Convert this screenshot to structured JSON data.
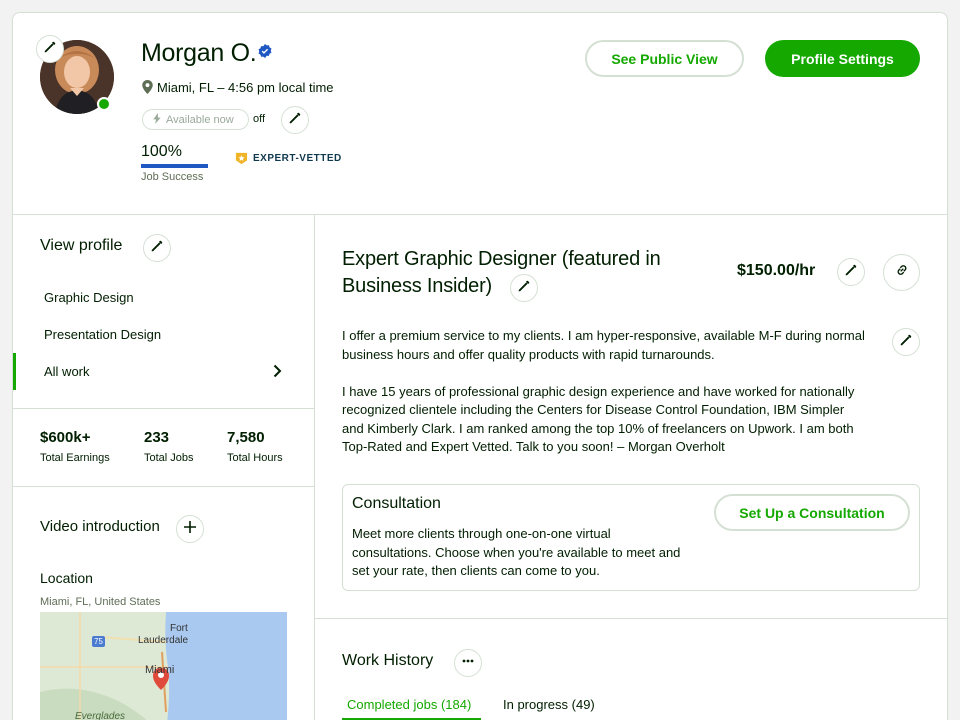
{
  "profile": {
    "name": "Morgan O.",
    "location": "Miami, FL – 4:56 pm local time",
    "availability_label": "Available now",
    "availability_state": "off",
    "job_success_value": "100%",
    "job_success_fraction": 1.0,
    "job_success_label": "Job Success",
    "badge_label": "EXPERT-VETTED",
    "online_status_color": "#14a800"
  },
  "header_actions": {
    "public_view_label": "See Public View",
    "settings_label": "Profile Settings"
  },
  "sidebar": {
    "view_profile_title": "View profile",
    "items": [
      {
        "label": "Graphic Design"
      },
      {
        "label": "Presentation Design"
      },
      {
        "label": "All work"
      }
    ],
    "stats": [
      {
        "value": "$600k+",
        "label": "Total Earnings"
      },
      {
        "value": "233",
        "label": "Total Jobs"
      },
      {
        "value": "7,580",
        "label": "Total Hours"
      }
    ],
    "video_title": "Video introduction",
    "location_title": "Location",
    "location_value": "Miami, FL, United States",
    "map_labels": {
      "fort": "Fort",
      "lauderdale": "Lauderdale",
      "miami": "Miami",
      "everglades": "Everglades",
      "route": "75"
    }
  },
  "main": {
    "title_line1": "Expert Graphic Designer (featured in",
    "title_line2": "Business Insider)",
    "rate": "$150.00/hr",
    "description_p1_l1": "I offer a premium service to my clients. I am hyper-responsive, available M-F during normal",
    "description_p1_l2": "business hours and offer quality products with rapid turnarounds.",
    "description_p2_l1": "I have 15 years of professional graphic design experience and have worked for nationally",
    "description_p2_l2": "recognized clientele including the Centers for Disease Control Foundation, IBM Simpler",
    "description_p2_l3": "and Kimberly Clark. I am ranked among the top 10% of freelancers on Upwork. I am both",
    "description_p2_l4": "Top-Rated and Expert Vetted. Talk to you soon! – Morgan Overholt",
    "consultation": {
      "title": "Consultation",
      "line1": "Meet more clients through one-on-one virtual",
      "line2": "consultations. Choose when you're available to meet and",
      "line3": "set your rate, then clients can come to you.",
      "button_label": "Set Up a Consultation"
    },
    "work_history": {
      "title": "Work History",
      "tabs": [
        {
          "label": "Completed jobs (184)",
          "active": true
        },
        {
          "label": "In progress (49)",
          "active": false
        }
      ]
    }
  },
  "colors": {
    "brand_green": "#14a800",
    "verified_blue": "#1f57c3",
    "badge_gold": "#f0b429"
  }
}
